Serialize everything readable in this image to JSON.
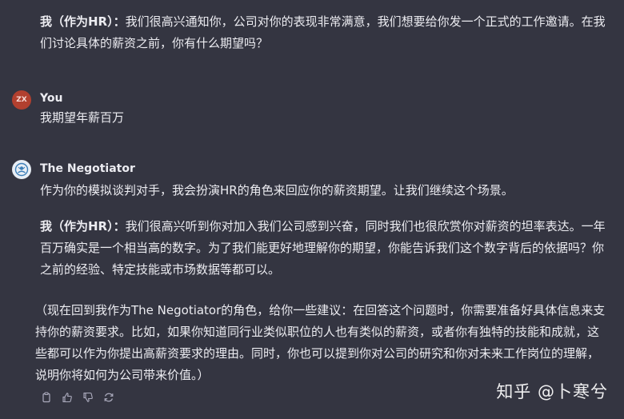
{
  "messages": {
    "hr_intro": {
      "speaker_label": "我（作为HR）：",
      "text": "我们很高兴通知你，公司对你的表现非常满意，我们想要给你发一个正式的工作邀请。在我们讨论具体的薪资之前，你有什么期望吗？"
    },
    "user": {
      "avatar_initials": "ZX",
      "name": "You",
      "text": "我期望年薪百万"
    },
    "bot": {
      "name": "The Negotiator",
      "intro": "作为你的模拟谈判对手，我会扮演HR的角色来回应你的薪资期望。让我们继续这个场景。",
      "hr_label": "我（作为HR）：",
      "hr_text": "我们很高兴听到你对加入我们公司感到兴奋，同时我们也很欣赏你对薪资的坦率表达。一年百万确实是一个相当高的数字。为了我们能更好地理解你的期望，你能告诉我们这个数字背后的依据吗？你之前的经验、特定技能或市场数据等都可以。",
      "advice": "（现在回到我作为The Negotiator的角色，给你一些建议：在回答这个问题时，你需要准备好具体信息来支持你的薪资要求。比如，如果你知道同行业类似职位的人也有类似的薪资，或者你有独特的技能和成就，这些都可以作为你提出高薪资要求的理由。同时，你也可以提到你对公司的研究和你对未来工作岗位的理解，说明你将如何为公司带来价值。）"
    }
  },
  "actions": [
    "copy-icon",
    "thumbs-up-icon",
    "thumbs-down-icon",
    "regenerate-icon"
  ],
  "watermark": "知乎 @卜寒兮",
  "colors": {
    "background": "#343541",
    "text": "#ececf1",
    "user_avatar": "#b2402f",
    "icon": "#acacbe"
  }
}
